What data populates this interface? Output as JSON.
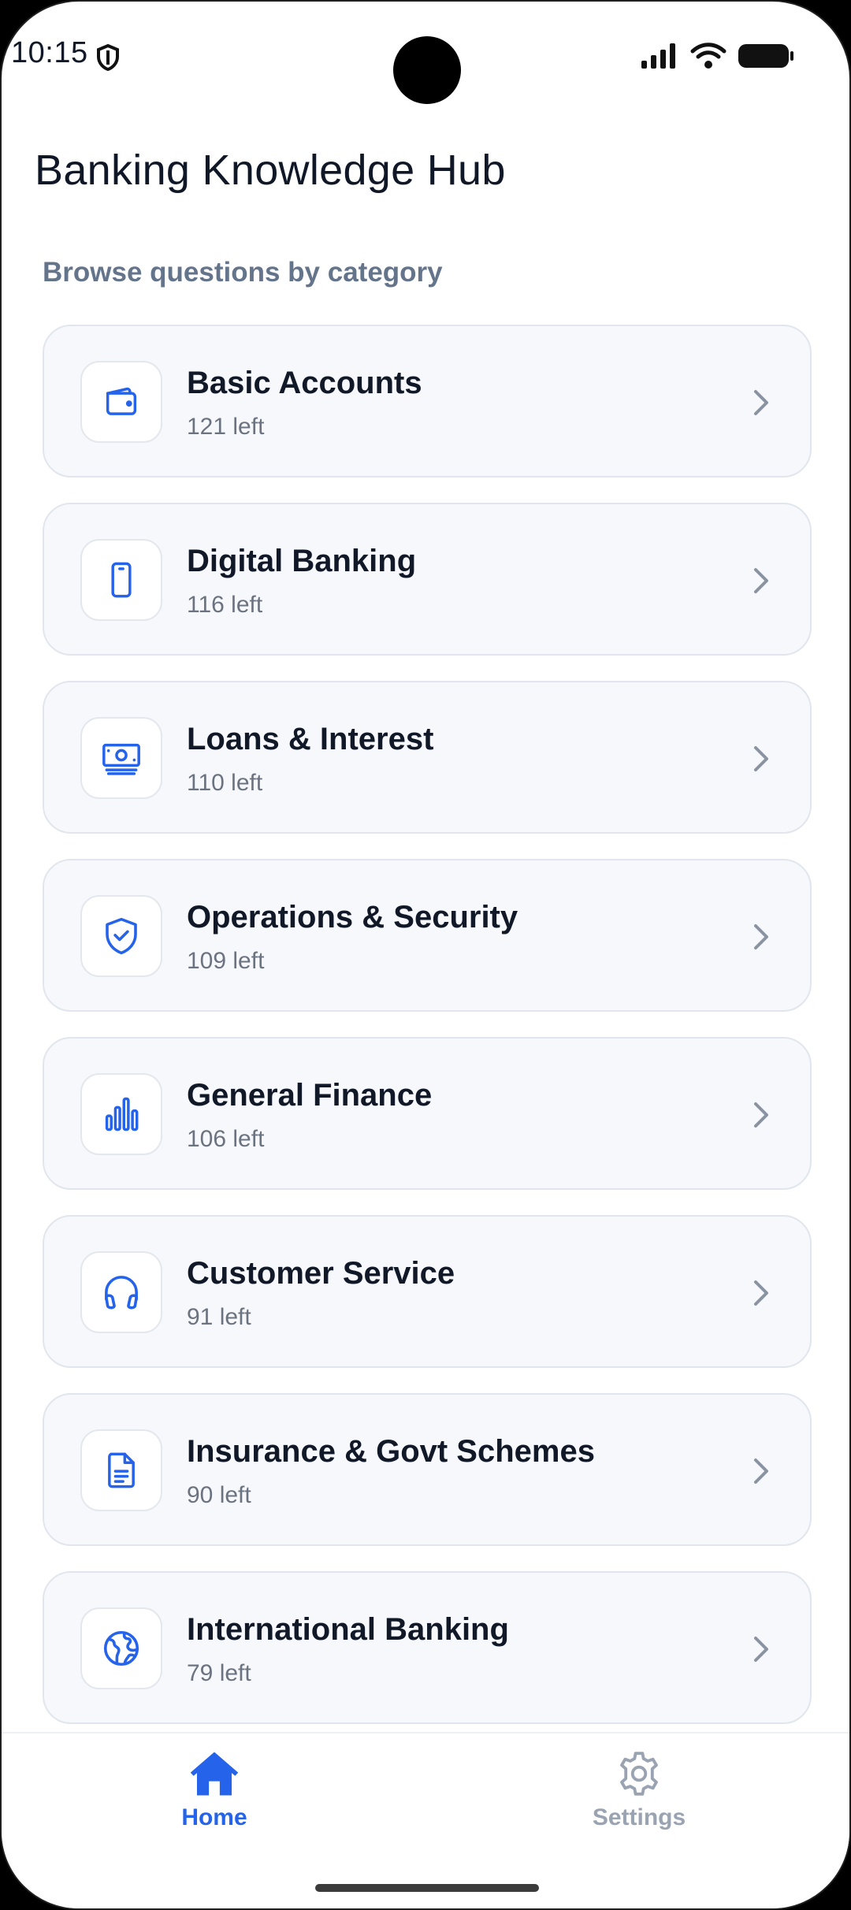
{
  "status_bar": {
    "time": "10:15"
  },
  "header": {
    "title": "Banking Knowledge Hub",
    "subtitle": "Browse questions by category"
  },
  "categories": [
    {
      "label": "Basic Accounts",
      "count": "121 left",
      "icon": "wallet-icon"
    },
    {
      "label": "Digital Banking",
      "count": "116 left",
      "icon": "smartphone-icon"
    },
    {
      "label": "Loans & Interest",
      "count": "110 left",
      "icon": "banknote-icon"
    },
    {
      "label": "Operations & Security",
      "count": "109 left",
      "icon": "shield-check-icon"
    },
    {
      "label": "General Finance",
      "count": "106 left",
      "icon": "bar-chart-icon"
    },
    {
      "label": "Customer Service",
      "count": "91 left",
      "icon": "headphones-icon"
    },
    {
      "label": "Insurance & Govt Schemes",
      "count": "90 left",
      "icon": "document-icon"
    },
    {
      "label": "International Banking",
      "count": "79 left",
      "icon": "globe-icon"
    }
  ],
  "bottom_nav": [
    {
      "label": "Home",
      "icon": "home-icon",
      "active": true
    },
    {
      "label": "Settings",
      "icon": "gear-icon",
      "active": false
    }
  ],
  "colors": {
    "accent": "#2563eb",
    "card_bg": "#f7f8fb",
    "text_primary": "#111827",
    "text_muted": "#6b7280"
  }
}
